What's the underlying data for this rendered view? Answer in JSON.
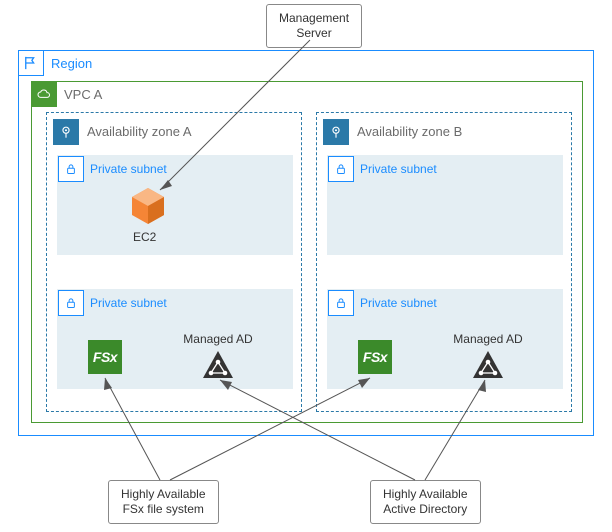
{
  "callouts": {
    "management_server": "Management\nServer",
    "ha_fsx": "Highly Available\nFSx file system",
    "ha_ad": "Highly Available\nActive Directory"
  },
  "region": {
    "label": "Region"
  },
  "vpc": {
    "label": "VPC A"
  },
  "availability_zones": {
    "a": {
      "label": "Availability zone A"
    },
    "b": {
      "label": "Availability zone B"
    }
  },
  "subnets": {
    "private_label": "Private subnet"
  },
  "resources": {
    "ec2_label": "EC2",
    "fsx_label": "FSx",
    "managed_ad_label": "Managed AD"
  }
}
